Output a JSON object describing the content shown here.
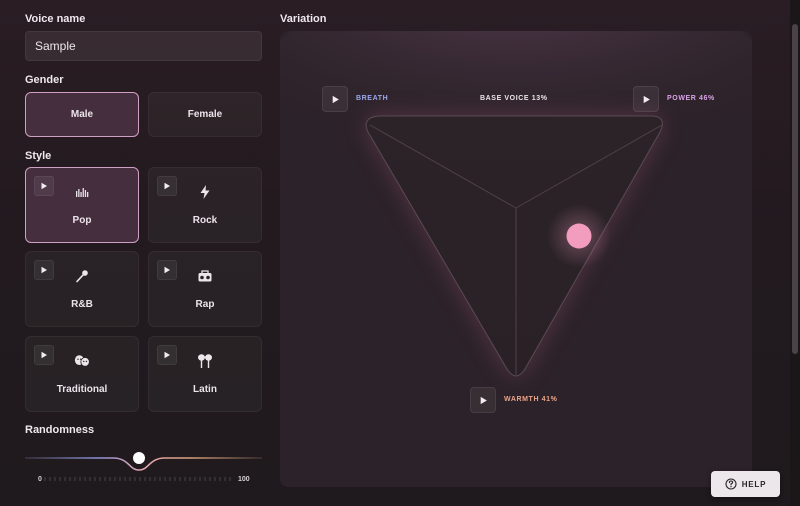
{
  "voice_name": {
    "label": "Voice name",
    "value": "Sample"
  },
  "gender": {
    "label": "Gender",
    "options": [
      "Male",
      "Female"
    ],
    "selected": "Male"
  },
  "style": {
    "label": "Style",
    "selected": "Pop",
    "cards": [
      {
        "label": "Pop",
        "icon": "equalizer-icon"
      },
      {
        "label": "Rock",
        "icon": "lightning-icon"
      },
      {
        "label": "R&B",
        "icon": "microphone-icon"
      },
      {
        "label": "Rap",
        "icon": "boombox-icon"
      },
      {
        "label": "Traditional",
        "icon": "theater-masks-icon"
      },
      {
        "label": "Latin",
        "icon": "maracas-icon"
      }
    ]
  },
  "randomness": {
    "label": "Randomness",
    "min": "0",
    "max": "100",
    "value": 50
  },
  "variation": {
    "label": "Variation",
    "breath": "BREATH",
    "base_voice": "BASE VOICE 13%",
    "power": "POWER 46%",
    "warmth": "WARMTH 41%",
    "colors": {
      "breath": "#9aa8f0",
      "power": "#d9a2e6",
      "warmth": "#eba488",
      "handle": "#f29dbd",
      "base": "#ece6ea"
    }
  },
  "help": {
    "label": "HELP",
    "icon": "help-circle-icon"
  }
}
